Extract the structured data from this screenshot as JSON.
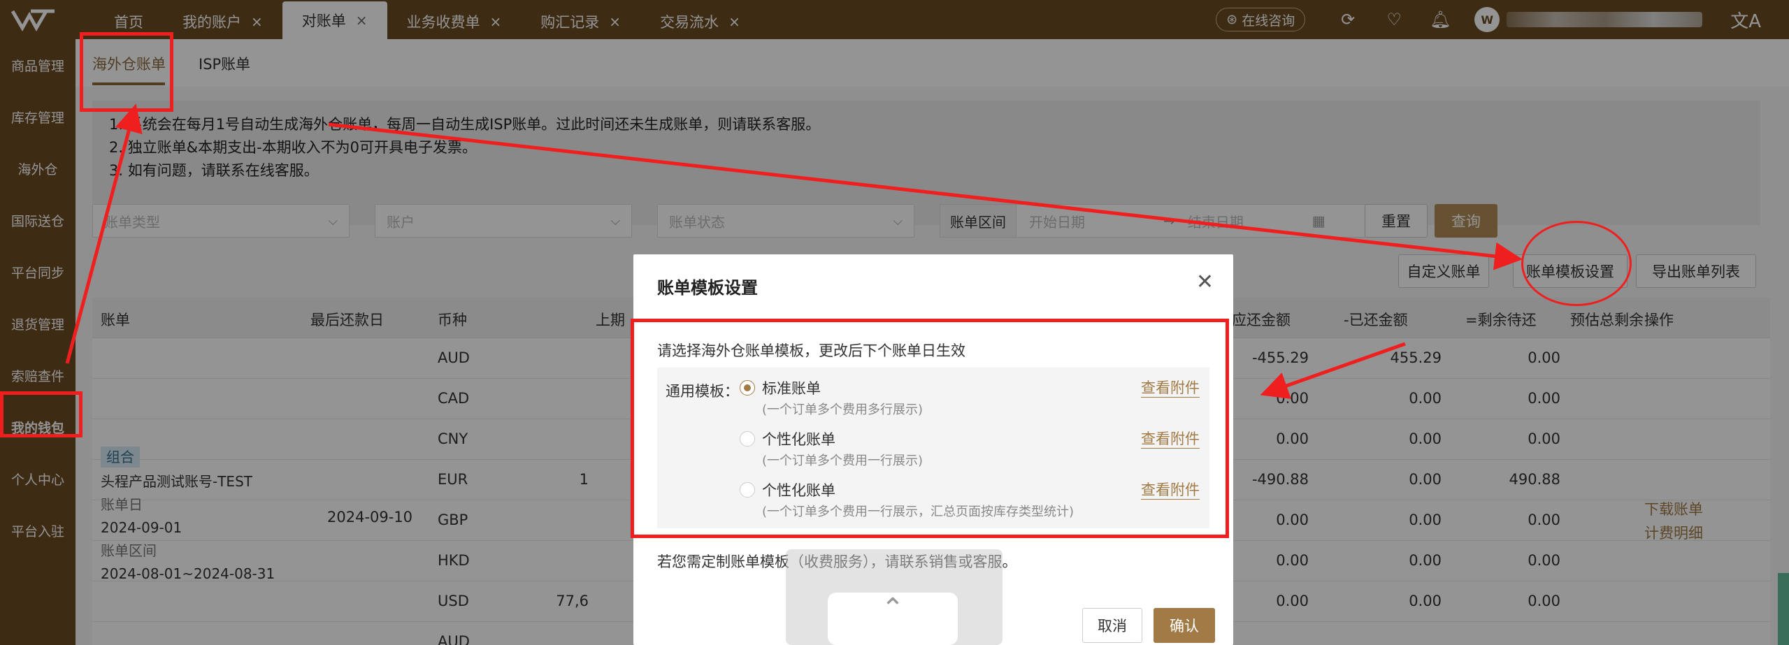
{
  "topbar": {
    "tabs": [
      {
        "label": "首页",
        "closable": false,
        "active": false
      },
      {
        "label": "我的账户",
        "closable": true,
        "active": false
      },
      {
        "label": "对账单",
        "closable": true,
        "active": true
      },
      {
        "label": "业务收费单",
        "closable": true,
        "active": false
      },
      {
        "label": "购汇记录",
        "closable": true,
        "active": false
      },
      {
        "label": "交易流水",
        "closable": true,
        "active": false
      }
    ],
    "close_glyph": "×",
    "consult_label": "在线咨询",
    "avatar_text": "W",
    "lang_glyph": "文A"
  },
  "sidebar": {
    "items": [
      "商品管理",
      "库存管理",
      "海外仓",
      "国际送仓",
      "平台同步",
      "退货管理",
      "索赔查件",
      "我的钱包",
      "个人中心",
      "平台入驻"
    ],
    "active_index": 7
  },
  "subtabs": [
    "海外仓账单",
    "ISP账单"
  ],
  "notice": [
    "1. 系统会在每月1号自动生成海外仓账单，每周一自动生成ISP账单。过此时间还未生成账单，则请联系客服。",
    "2. 独立账单&本期支出-本期收入不为0可开具电子发票。",
    "3. 如有问题，请联系在线客服。"
  ],
  "filters": {
    "bill_type": "账单类型",
    "account": "账户",
    "bill_status": "账单状态",
    "range_label": "账单区间",
    "start_date": "开始日期",
    "end_date": "结束日期",
    "reset": "重置",
    "query": "查询"
  },
  "actions": {
    "custom_bill": "自定义账单",
    "template_settings": "账单模板设置",
    "export_list": "导出账单列表"
  },
  "table": {
    "headers": [
      "账单",
      "最后还款日",
      "币种",
      "上期",
      "应还金额",
      "-已还金额",
      "=剩余待还",
      "预估总剩余",
      "操作"
    ],
    "rows": [
      {
        "currency": "AUD",
        "due": "-455.29",
        "paid": "455.29",
        "remain": "0.00",
        "prev": ""
      },
      {
        "currency": "CAD",
        "due": "0.00",
        "paid": "0.00",
        "remain": "0.00",
        "prev": ""
      },
      {
        "currency": "CNY",
        "due": "0.00",
        "paid": "0.00",
        "remain": "0.00",
        "prev": ""
      },
      {
        "currency": "EUR",
        "due": "-490.88",
        "paid": "0.00",
        "remain": "490.88",
        "prev": "1"
      },
      {
        "currency": "GBP",
        "due": "0.00",
        "paid": "0.00",
        "remain": "0.00",
        "prev": ""
      },
      {
        "currency": "HKD",
        "due": "0.00",
        "paid": "0.00",
        "remain": "0.00",
        "prev": ""
      },
      {
        "currency": "USD",
        "due": "0.00",
        "paid": "0.00",
        "remain": "0.00",
        "prev": "77,6"
      },
      {
        "currency": "AUD",
        "due": "",
        "paid": "",
        "remain": "",
        "prev": ""
      }
    ],
    "account": {
      "tag": "组合",
      "name": "头程产品测试账号-TEST",
      "bill_day_label": "账单日",
      "bill_day": "2024-09-01",
      "range_label": "账单区间",
      "range": "2024-08-01~2024-08-31",
      "last_due": "2024-09-10"
    },
    "links": [
      "下载账单",
      "计费明细"
    ]
  },
  "modal": {
    "title": "账单模板设置",
    "subtitle": "请选择海外仓账单模板，更改后下个账单日生效",
    "general_label": "通用模板：",
    "options": [
      {
        "title": "标准账单",
        "desc": "(一个订单多个费用多行展示)",
        "checked": true
      },
      {
        "title": "个性化账单",
        "desc": "(一个订单多个费用一行展示)",
        "checked": false
      },
      {
        "title": "个性化账单",
        "desc": "(一个订单多个费用一行展示，汇总页面按库存类型统计)",
        "checked": false
      }
    ],
    "view_attachment": "查看附件",
    "note": "若您需定制账单模板（收费服务），请联系销售或客服。",
    "cancel": "取消",
    "confirm": "确认"
  },
  "accent_color": "#a27a45",
  "topbar_color": "#6b4a24",
  "annotation_color": "#f01f1f"
}
